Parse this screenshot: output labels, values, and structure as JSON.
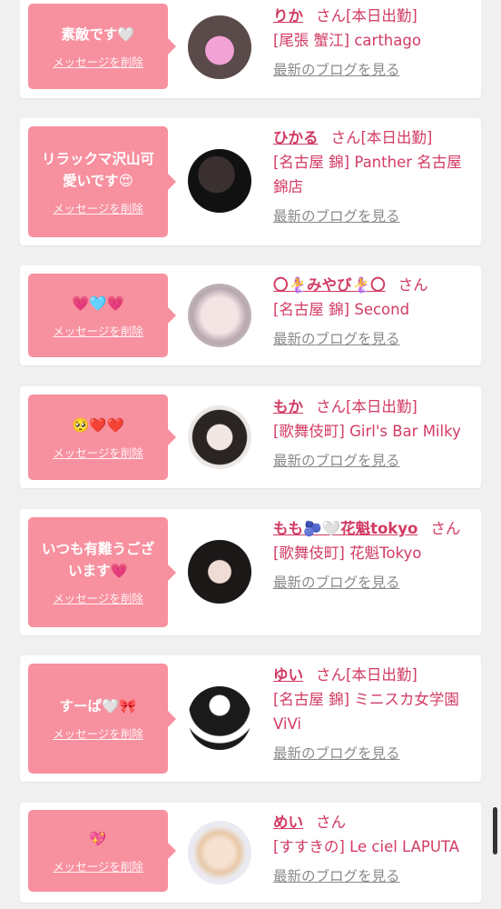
{
  "delete_label": "メッセージを削除",
  "blog_label": "最新のブログを見る",
  "san": "さん",
  "items": [
    {
      "message": "素敵です🤍",
      "name": "りか",
      "status": "[本日出勤]",
      "shop": "[尾張 蟹江] carthago"
    },
    {
      "message": "リラックマ沢山可愛いです😍",
      "name": "ひかる",
      "status": "[本日出勤]",
      "shop": "[名古屋 錦] Panther 名古屋錦店"
    },
    {
      "message": "💗🩵💗",
      "name": "〇🧜‍♀️みやび🧜‍♀️〇",
      "status": "",
      "shop": "[名古屋 錦] Second"
    },
    {
      "message": "🥺❤️❤️",
      "name": "もか",
      "status": "[本日出勤]",
      "shop": "[歌舞伎町] Girl's Bar Milky"
    },
    {
      "message": "いつも有難うございます💗",
      "name": "もも🫐🤍花魁tokyo",
      "status": "",
      "shop": "[歌舞伎町] 花魁Tokyo"
    },
    {
      "message": "すーぱ🤍🎀",
      "name": "ゆい",
      "status": "[本日出勤]",
      "shop": "[名古屋 錦] ミニスカ女学園ViVi"
    },
    {
      "message": "💖",
      "name": "めい",
      "status": "",
      "shop": "[すすきの] Le ciel LAPUTA"
    }
  ],
  "colors": {
    "accent": "#d23b63",
    "bubble": "#f7909f",
    "link_gray": "#8a8a8a"
  }
}
